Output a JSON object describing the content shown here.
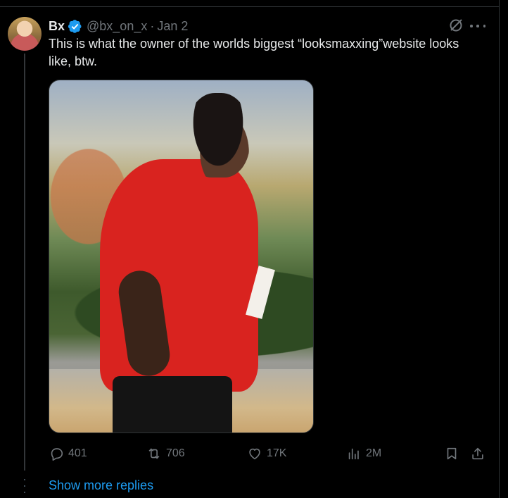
{
  "post": {
    "author_name": "Bx",
    "handle": "@bx_on_x",
    "separator": "·",
    "date": "Jan 2",
    "text": "This is what the owner of the worlds biggest “looksmaxxing”website looks like, btw.",
    "verified_icon": "verified-badge-icon",
    "accent_color": "#1d9bf0"
  },
  "actions": {
    "replies": "401",
    "reposts": "706",
    "likes": "17K",
    "views": "2M"
  },
  "thread": {
    "show_more": "Show more replies"
  }
}
